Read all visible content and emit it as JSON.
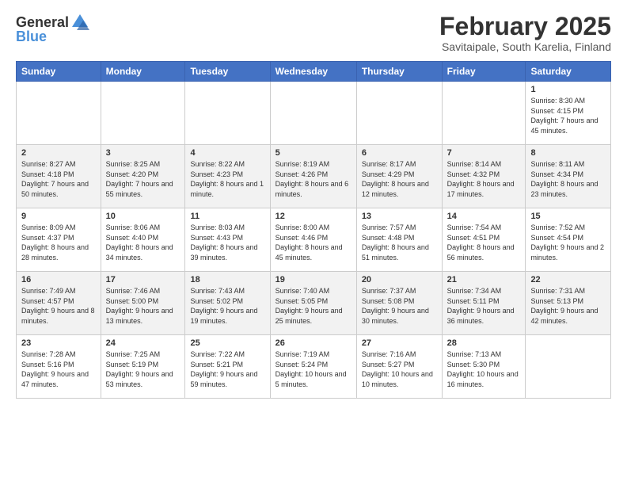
{
  "header": {
    "logo_general": "General",
    "logo_blue": "Blue",
    "title": "February 2025",
    "location": "Savitaipale, South Karelia, Finland"
  },
  "weekdays": [
    "Sunday",
    "Monday",
    "Tuesday",
    "Wednesday",
    "Thursday",
    "Friday",
    "Saturday"
  ],
  "weeks": [
    [
      {
        "day": "",
        "info": ""
      },
      {
        "day": "",
        "info": ""
      },
      {
        "day": "",
        "info": ""
      },
      {
        "day": "",
        "info": ""
      },
      {
        "day": "",
        "info": ""
      },
      {
        "day": "",
        "info": ""
      },
      {
        "day": "1",
        "info": "Sunrise: 8:30 AM\nSunset: 4:15 PM\nDaylight: 7 hours and 45 minutes."
      }
    ],
    [
      {
        "day": "2",
        "info": "Sunrise: 8:27 AM\nSunset: 4:18 PM\nDaylight: 7 hours and 50 minutes."
      },
      {
        "day": "3",
        "info": "Sunrise: 8:25 AM\nSunset: 4:20 PM\nDaylight: 7 hours and 55 minutes."
      },
      {
        "day": "4",
        "info": "Sunrise: 8:22 AM\nSunset: 4:23 PM\nDaylight: 8 hours and 1 minute."
      },
      {
        "day": "5",
        "info": "Sunrise: 8:19 AM\nSunset: 4:26 PM\nDaylight: 8 hours and 6 minutes."
      },
      {
        "day": "6",
        "info": "Sunrise: 8:17 AM\nSunset: 4:29 PM\nDaylight: 8 hours and 12 minutes."
      },
      {
        "day": "7",
        "info": "Sunrise: 8:14 AM\nSunset: 4:32 PM\nDaylight: 8 hours and 17 minutes."
      },
      {
        "day": "8",
        "info": "Sunrise: 8:11 AM\nSunset: 4:34 PM\nDaylight: 8 hours and 23 minutes."
      }
    ],
    [
      {
        "day": "9",
        "info": "Sunrise: 8:09 AM\nSunset: 4:37 PM\nDaylight: 8 hours and 28 minutes."
      },
      {
        "day": "10",
        "info": "Sunrise: 8:06 AM\nSunset: 4:40 PM\nDaylight: 8 hours and 34 minutes."
      },
      {
        "day": "11",
        "info": "Sunrise: 8:03 AM\nSunset: 4:43 PM\nDaylight: 8 hours and 39 minutes."
      },
      {
        "day": "12",
        "info": "Sunrise: 8:00 AM\nSunset: 4:46 PM\nDaylight: 8 hours and 45 minutes."
      },
      {
        "day": "13",
        "info": "Sunrise: 7:57 AM\nSunset: 4:48 PM\nDaylight: 8 hours and 51 minutes."
      },
      {
        "day": "14",
        "info": "Sunrise: 7:54 AM\nSunset: 4:51 PM\nDaylight: 8 hours and 56 minutes."
      },
      {
        "day": "15",
        "info": "Sunrise: 7:52 AM\nSunset: 4:54 PM\nDaylight: 9 hours and 2 minutes."
      }
    ],
    [
      {
        "day": "16",
        "info": "Sunrise: 7:49 AM\nSunset: 4:57 PM\nDaylight: 9 hours and 8 minutes."
      },
      {
        "day": "17",
        "info": "Sunrise: 7:46 AM\nSunset: 5:00 PM\nDaylight: 9 hours and 13 minutes."
      },
      {
        "day": "18",
        "info": "Sunrise: 7:43 AM\nSunset: 5:02 PM\nDaylight: 9 hours and 19 minutes."
      },
      {
        "day": "19",
        "info": "Sunrise: 7:40 AM\nSunset: 5:05 PM\nDaylight: 9 hours and 25 minutes."
      },
      {
        "day": "20",
        "info": "Sunrise: 7:37 AM\nSunset: 5:08 PM\nDaylight: 9 hours and 30 minutes."
      },
      {
        "day": "21",
        "info": "Sunrise: 7:34 AM\nSunset: 5:11 PM\nDaylight: 9 hours and 36 minutes."
      },
      {
        "day": "22",
        "info": "Sunrise: 7:31 AM\nSunset: 5:13 PM\nDaylight: 9 hours and 42 minutes."
      }
    ],
    [
      {
        "day": "23",
        "info": "Sunrise: 7:28 AM\nSunset: 5:16 PM\nDaylight: 9 hours and 47 minutes."
      },
      {
        "day": "24",
        "info": "Sunrise: 7:25 AM\nSunset: 5:19 PM\nDaylight: 9 hours and 53 minutes."
      },
      {
        "day": "25",
        "info": "Sunrise: 7:22 AM\nSunset: 5:21 PM\nDaylight: 9 hours and 59 minutes."
      },
      {
        "day": "26",
        "info": "Sunrise: 7:19 AM\nSunset: 5:24 PM\nDaylight: 10 hours and 5 minutes."
      },
      {
        "day": "27",
        "info": "Sunrise: 7:16 AM\nSunset: 5:27 PM\nDaylight: 10 hours and 10 minutes."
      },
      {
        "day": "28",
        "info": "Sunrise: 7:13 AM\nSunset: 5:30 PM\nDaylight: 10 hours and 16 minutes."
      },
      {
        "day": "",
        "info": ""
      }
    ]
  ]
}
